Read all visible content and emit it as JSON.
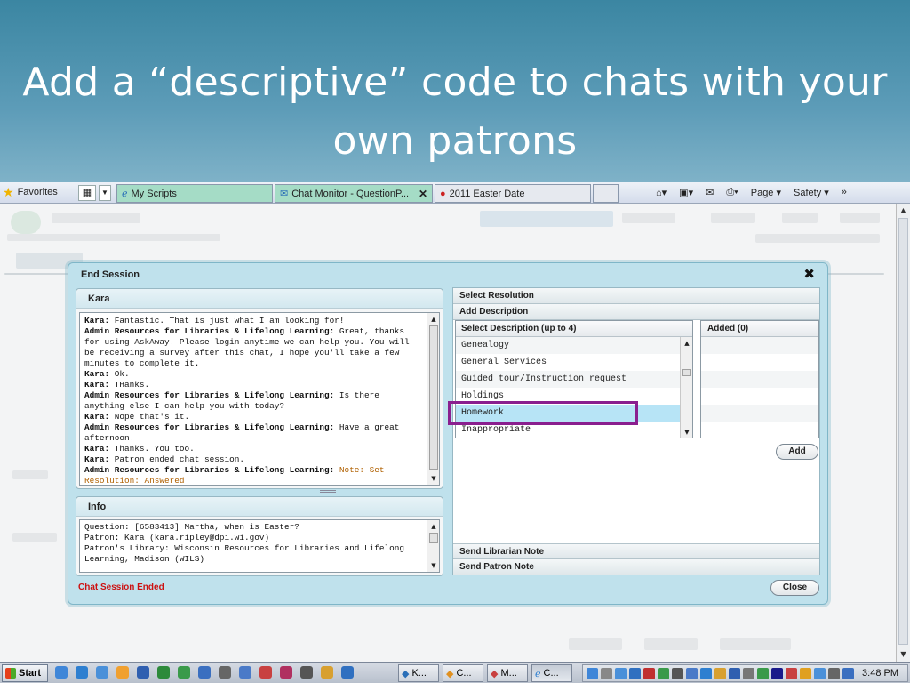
{
  "slide": {
    "title": "Add a “descriptive” code to chats with your own patrons"
  },
  "browser": {
    "favorites_label": "Favorites",
    "tabs": [
      {
        "label": "My Scripts",
        "icon": "ie-icon",
        "active": false
      },
      {
        "label": "Chat Monitor - QuestionP...",
        "icon": "chat-icon",
        "active": true
      },
      {
        "label": "2011 Easter Date",
        "icon": "opera-icon",
        "active": false
      }
    ],
    "commands": {
      "page": "Page ▾",
      "safety": "Safety ▾"
    }
  },
  "dialog": {
    "title": "End Session",
    "close_symbol": "✖",
    "chat_panel": {
      "header": "Kara",
      "messages": [
        {
          "who": "Kara:",
          "text": " Fantastic. That is just what I am looking for!"
        },
        {
          "who": "Admin Resources for Libraries & Lifelong Learning:",
          "text": " Great, thanks for using AskAway!  Please login anytime we can help you.  You will be receiving a survey after this chat, I hope you'll take a few minutes to complete it."
        },
        {
          "who": "Kara:",
          "text": " Ok."
        },
        {
          "who": "Kara:",
          "text": " THanks."
        },
        {
          "who": "Admin Resources for Libraries & Lifelong Learning:",
          "text": " Is there anything else I can help you with today?"
        },
        {
          "who": "Kara:",
          "text": " Nope that's it."
        },
        {
          "who": "Admin Resources for Libraries & Lifelong Learning:",
          "text": " Have a great afternoon!"
        },
        {
          "who": "Kara:",
          "text": " Thanks. You too."
        },
        {
          "who": "Kara:",
          "text": " Patron ended chat session."
        },
        {
          "who": "Admin Resources for Libraries & Lifelong Learning:",
          "text": "",
          "note": " Note: Set Resolution: Answered"
        }
      ]
    },
    "info_panel": {
      "header": "Info",
      "lines": [
        "Question: [6583413] Martha, when is Easter?",
        "Patron: Kara (kara.ripley@dpi.wi.gov)",
        "Patron's Library: Wisconsin Resources for Libraries and Lifelong Learning, Madison (WILS)"
      ]
    },
    "status_text": "Chat Session Ended",
    "right": {
      "select_resolution": "Select Resolution",
      "add_description": "Add Description",
      "list_header": "Select Description (up to 4)",
      "options": [
        "Genealogy",
        "General Services",
        "Guided tour/Instruction request",
        "Holdings",
        "Homework",
        "Inappropriate"
      ],
      "selected_option": "Homework",
      "added_header": "Added (0)",
      "add_button": "Add",
      "send_librarian_note": "Send Librarian Note",
      "send_patron_note": "Send Patron Note"
    },
    "close_button": "Close"
  },
  "taskbar": {
    "start_label": "Start",
    "tasks": [
      {
        "label": "K...",
        "active": false
      },
      {
        "label": "C...",
        "active": false
      },
      {
        "label": "M...",
        "active": false
      },
      {
        "label": "C...",
        "active": true
      }
    ],
    "clock": "3:48 PM"
  },
  "colors": {
    "highlight_box": "#8a1f8f",
    "selected_row": "#b7e4f6",
    "ended_text": "#cc1111"
  }
}
